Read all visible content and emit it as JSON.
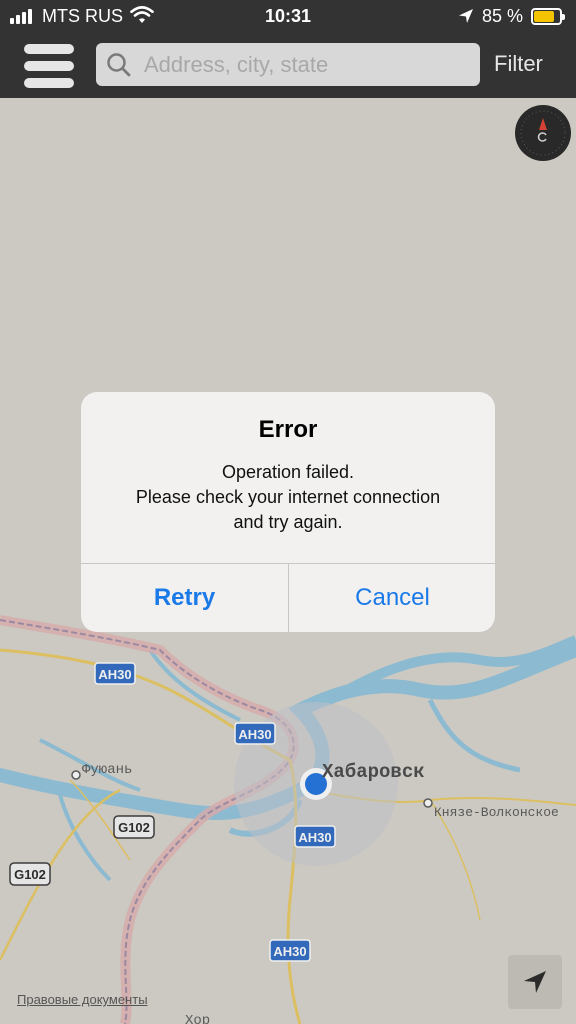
{
  "status_bar": {
    "carrier": "MTS RUS",
    "time": "10:31",
    "battery_percent": "85 %",
    "battery_level": 0.85,
    "battery_color": "#f5c400",
    "icons": [
      "signal-icon",
      "wifi-icon",
      "location-arrow-icon",
      "battery-icon"
    ]
  },
  "nav": {
    "menu_icon": "hamburger-menu-icon",
    "search_placeholder": "Address, city, state",
    "search_value": "",
    "filter_label": "Filter"
  },
  "map": {
    "labels": {
      "khabarovsk": "Хабаровск",
      "fuyuan": "Фуюань",
      "knyaze": "Князе-Волконское",
      "khor": "Хор"
    },
    "road_shields": [
      "AH30",
      "AH30",
      "AH30",
      "AH30",
      "G102",
      "G102"
    ],
    "legal_link": "Правовые документы",
    "compass_icon": "compass-icon",
    "locate_icon": "navigation-arrow-icon"
  },
  "alert": {
    "title": "Error",
    "message_line1": "Operation failed.",
    "message_line2": "Please check your internet connection",
    "message_line3": "and try again.",
    "retry_label": "Retry",
    "cancel_label": "Cancel",
    "button_color": "#1a7ae8"
  }
}
